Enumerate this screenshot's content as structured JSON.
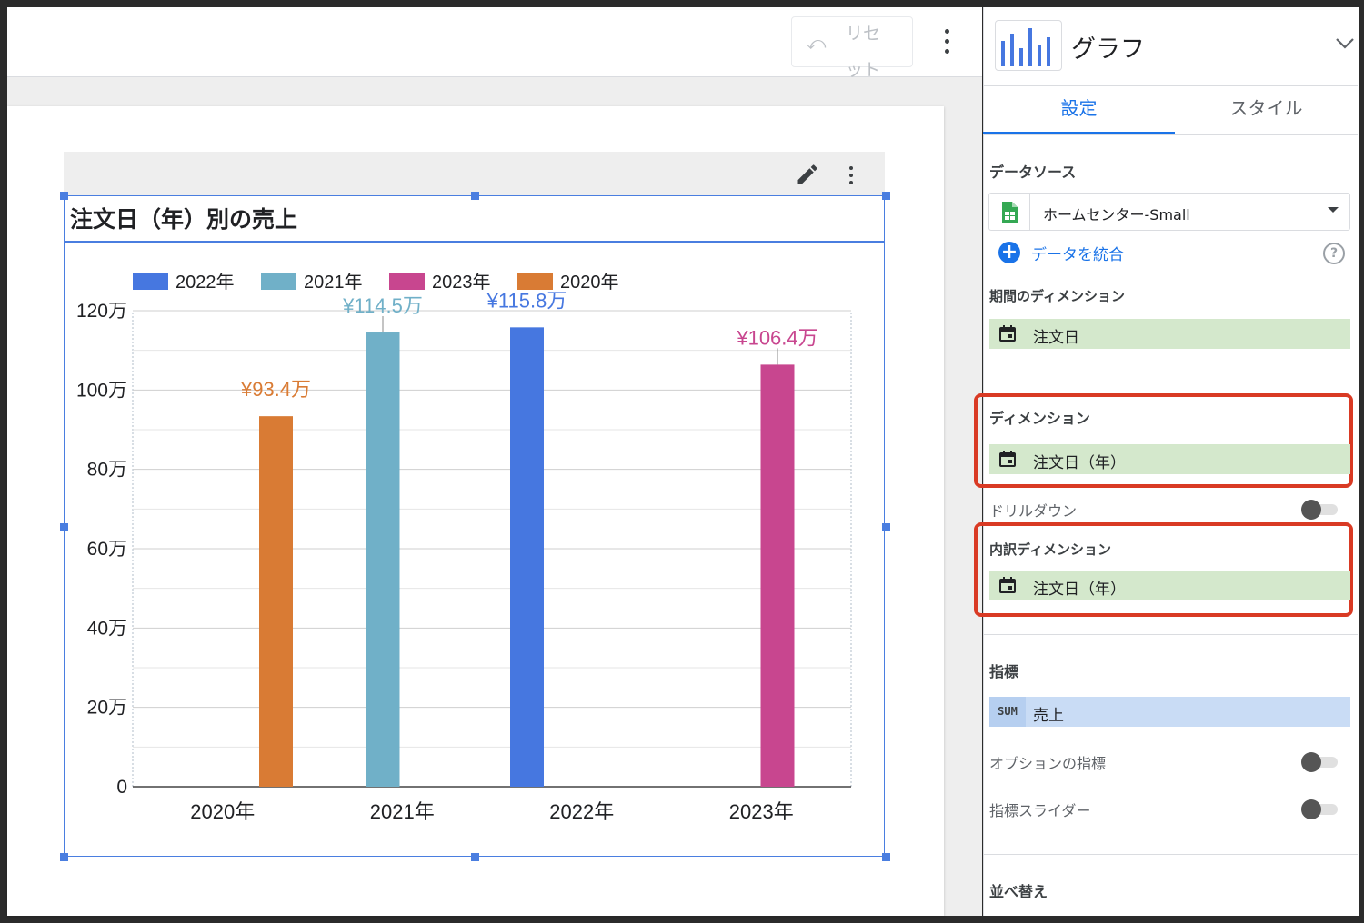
{
  "toolbar": {
    "reset_label": "リセット"
  },
  "chart": {
    "title": "注文日（年）別の売上"
  },
  "chart_data": {
    "type": "bar",
    "title": "注文日（年）別の売上",
    "categories": [
      "2020年",
      "2021年",
      "2022年",
      "2023年"
    ],
    "legend": [
      "2022年",
      "2021年",
      "2023年",
      "2020年"
    ],
    "legend_position": "top",
    "series": [
      {
        "name": "2020年",
        "color": "#d97b34",
        "category": "2020年",
        "value": 93.4,
        "label": "¥93.4万"
      },
      {
        "name": "2021年",
        "color": "#70b0c8",
        "category": "2021年",
        "value": 114.5,
        "label": "¥114.5万"
      },
      {
        "name": "2022年",
        "color": "#4677e0",
        "category": "2022年",
        "value": 115.8,
        "label": "¥115.8万"
      },
      {
        "name": "2023年",
        "color": "#c8468f",
        "category": "2023年",
        "value": 106.4,
        "label": "¥106.4万"
      }
    ],
    "y_ticks": [
      "0",
      "20万",
      "40万",
      "60万",
      "80万",
      "100万",
      "120万"
    ],
    "ylim": [
      0,
      120
    ],
    "grid": true
  },
  "panel": {
    "chart_type_label": "グラフ",
    "tabs": [
      "設定",
      "スタイル"
    ],
    "data_source_title": "データソース",
    "data_source_value": "ホームセンター-Small",
    "blend_label": "データを統合",
    "help_icon": "?",
    "date_range_title": "期間のディメンション",
    "date_range_value": "注文日",
    "dimension_title": "ディメンション",
    "dimension_value": "注文日（年）",
    "drilldown_label": "ドリルダウン",
    "breakdown_title": "内訳ディメンション",
    "breakdown_value": "注文日（年）",
    "metric_title": "指標",
    "metric_agg": "SUM",
    "metric_value": "売上",
    "optional_metrics_label": "オプションの指標",
    "metric_slider_label": "指標スライダー",
    "sort_title": "並べ替え"
  },
  "icons": [
    "undo-icon",
    "more-vert-icon",
    "edit-icon",
    "bar-chart-icon",
    "chevron-down-icon",
    "sheets-icon",
    "add-circle-icon",
    "help-icon",
    "calendar-icon"
  ]
}
